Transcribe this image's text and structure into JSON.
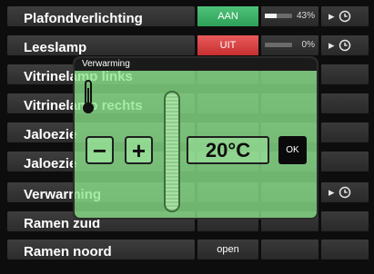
{
  "rows": [
    {
      "name": "Plafondverlichting",
      "status": "AAN",
      "state": "on",
      "level": 0.43,
      "percent": "43%",
      "has_timer": true
    },
    {
      "name": "Leeslamp",
      "status": "UIT",
      "state": "off",
      "level": 0.0,
      "percent": "0%",
      "has_timer": true
    },
    {
      "name": "Vitrinelamp links",
      "status": "",
      "state": "none",
      "has_timer": false
    },
    {
      "name": "Vitrinelamp rechts",
      "status": "",
      "state": "none",
      "has_timer": false
    },
    {
      "name": "Jaloezie",
      "status": "",
      "state": "none",
      "has_timer": false
    },
    {
      "name": "Jaloezie",
      "status": "",
      "state": "none",
      "has_timer": false
    },
    {
      "name": "Verwarming",
      "status": "",
      "state": "none",
      "has_timer": true
    },
    {
      "name": "Ramen zuid",
      "status": "",
      "state": "none",
      "has_timer": false
    },
    {
      "name": "Ramen noord",
      "status": "open",
      "state": "plain",
      "has_timer": false
    }
  ],
  "dialog": {
    "title": "Verwarming",
    "minus_label": "−",
    "plus_label": "+",
    "temperature": "20°C",
    "ok_label": "OK"
  },
  "icons": {
    "thermometer": "thermometer-icon",
    "timer": "clock-icon",
    "play": "play-arrow-icon"
  },
  "colors": {
    "on": "#2ea058",
    "off": "#c62f2f",
    "dialog_bg": "#8ce68c"
  }
}
